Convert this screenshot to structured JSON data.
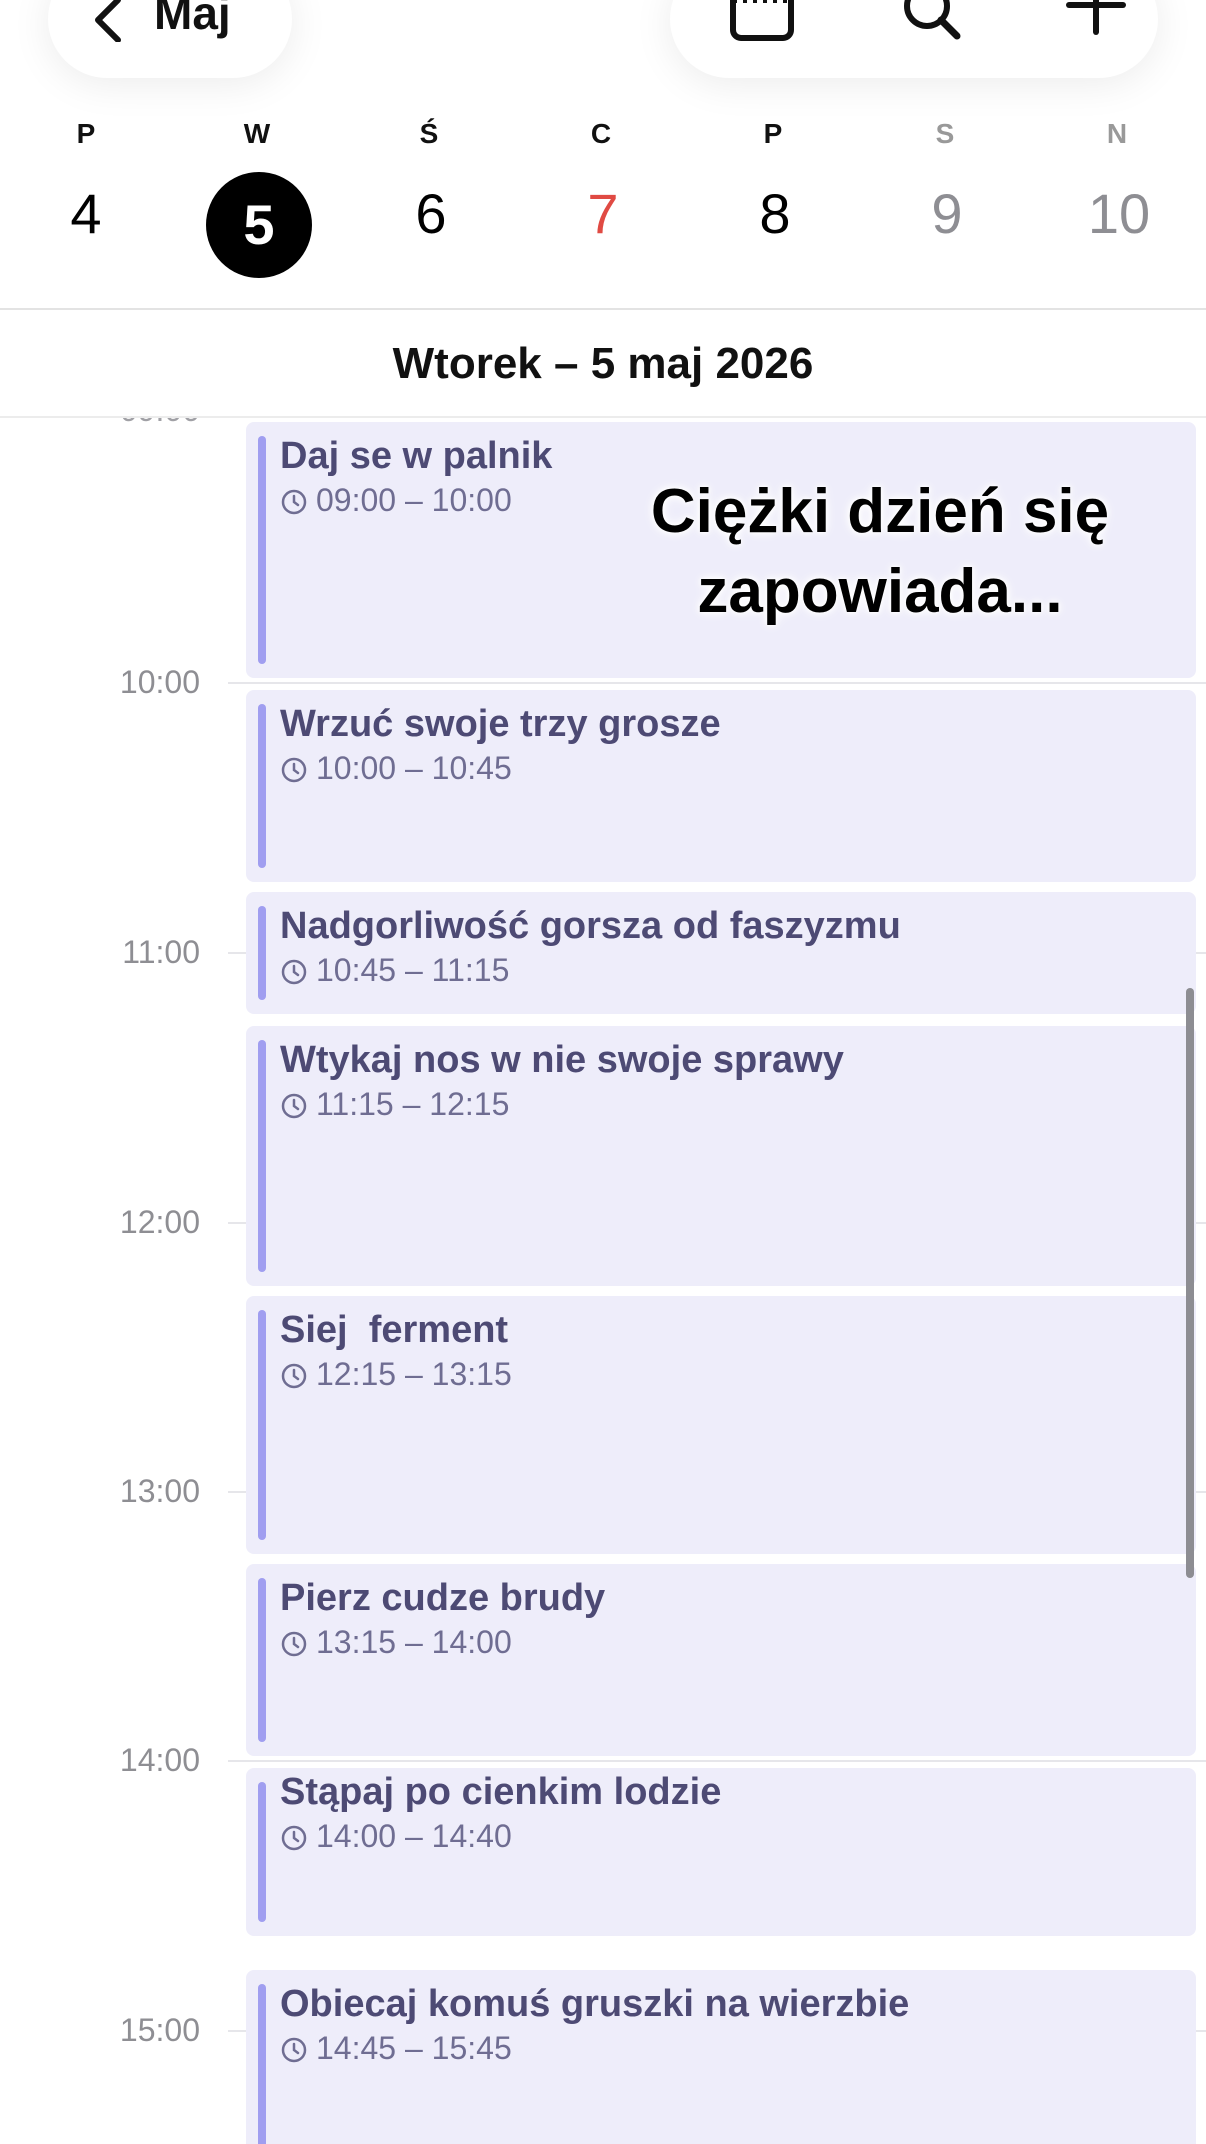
{
  "nav": {
    "back_label": "Maj",
    "icons": [
      "chevron-left-icon",
      "day-view-icon",
      "search-icon",
      "plus-icon"
    ]
  },
  "week": {
    "days": [
      {
        "dow": "P",
        "num": "4"
      },
      {
        "dow": "W",
        "num": "5",
        "selected": true
      },
      {
        "dow": "Ś",
        "num": "6"
      },
      {
        "dow": "C",
        "num": "7",
        "holiday": true
      },
      {
        "dow": "P",
        "num": "8"
      },
      {
        "dow": "S",
        "num": "9",
        "weekend": true
      },
      {
        "dow": "N",
        "num": "10",
        "weekend": true
      }
    ]
  },
  "date_title": "Wtorek – 5 maj 2026",
  "timeline": {
    "hours": [
      "10:00",
      "11:00",
      "12:00",
      "13:00",
      "14:00",
      "15:00"
    ],
    "events": [
      {
        "title": "Daj se w palnik",
        "time": "09:00 – 10:00"
      },
      {
        "title": "Wrzuć swoje trzy grosze",
        "time": "10:00 – 10:45"
      },
      {
        "title": "Nadgorliwość gorsza od faszyzmu",
        "time": "10:45 – 11:15"
      },
      {
        "title": "Wtykaj nos w nie swoje sprawy",
        "time": "11:15 – 12:15"
      },
      {
        "title": "Siej  ferment",
        "time": "12:15 – 13:15"
      },
      {
        "title": "Pierz cudze brudy",
        "time": "13:15 – 14:00"
      },
      {
        "title": "Stąpaj po cienkim lodzie",
        "time": "14:00 – 14:40"
      },
      {
        "title": "Obiecaj komuś gruszki na wierzbie",
        "time": "14:45 – 15:45"
      }
    ]
  },
  "caption": {
    "line1": "Ciężki dzień się",
    "line2": "zapowiada..."
  },
  "colors": {
    "event_bg": "#eeedfa",
    "event_bar": "#a09ef0",
    "event_text": "#4d4a74",
    "holiday": "#e04a43",
    "today_circle": "#000000"
  }
}
